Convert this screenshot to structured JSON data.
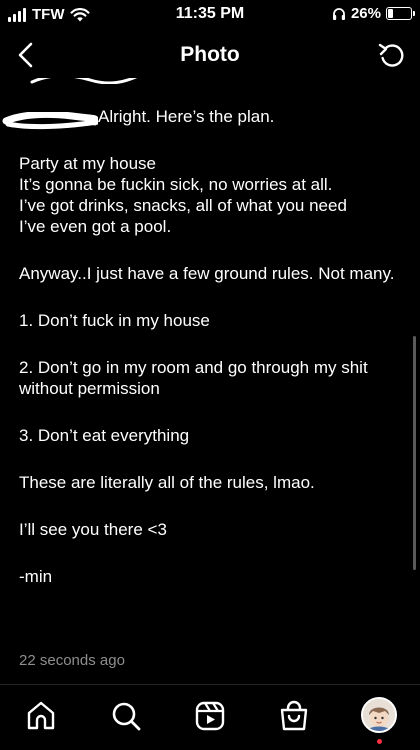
{
  "status_bar": {
    "carrier": "TFW",
    "time": "11:35 PM",
    "battery_percent_label": "26%",
    "battery_level": 0.26,
    "signal_bars": 4
  },
  "header": {
    "title": "Photo",
    "back_icon": "chevron-left-icon",
    "rotate_icon": "rotate-icon"
  },
  "post": {
    "lines": [
      "Alright. Here’s the plan.",
      "",
      "Party at my house",
      "It’s gonna be fuckin sick, no worries at all.",
      "I’ve got drinks, snacks, all of what you need",
      "I’ve even got a pool.",
      "",
      "Anyway..I just have a few ground rules. Not many.",
      "",
      "1. Don’t fuck in my house",
      "",
      "2. Don’t go in my room and go through my shit without permission",
      "",
      "3. Don’t eat everything",
      "",
      "These are literally all of the rules, lmao.",
      "",
      "I’ll see you there <3",
      "",
      "-min"
    ],
    "timestamp": "22 seconds ago"
  },
  "tab_bar": {
    "tabs": [
      "home-icon",
      "search-icon",
      "reels-icon",
      "shop-icon",
      "profile-avatar"
    ]
  },
  "colors": {
    "background": "#000000",
    "text": "#ffffff",
    "muted": "#8e8e8e",
    "notification": "#ff3040"
  }
}
